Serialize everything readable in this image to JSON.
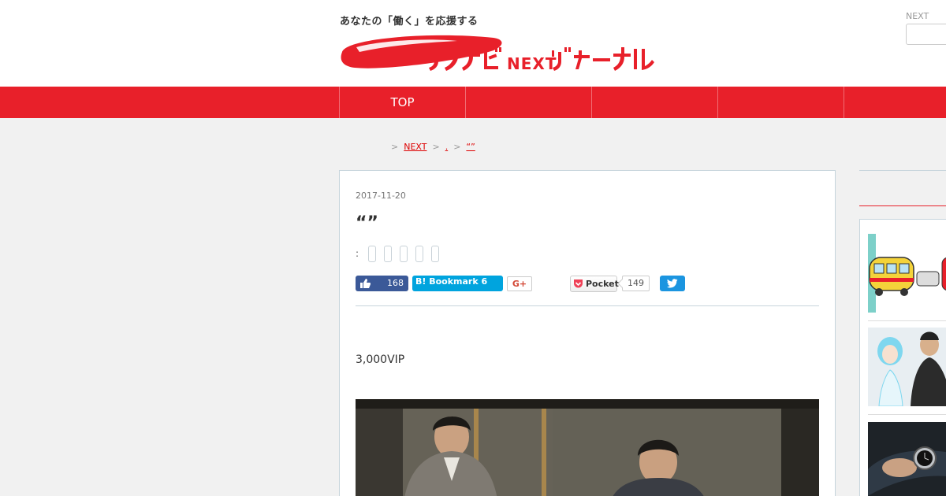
{
  "header": {
    "tagline": "あなたの「働く」を応援する",
    "logo_text": "リクナビNEXTジャーナル",
    "next_label": "NEXT",
    "search_placeholder": ""
  },
  "nav": {
    "items": [
      {
        "label": "TOP"
      },
      {
        "label": ""
      },
      {
        "label": ""
      },
      {
        "label": ""
      },
      {
        "label": ""
      }
    ]
  },
  "breadcrumb": {
    "items": [
      {
        "label": "          "
      },
      {
        "label": "NEXT "
      },
      {
        "label": "."
      },
      {
        "label": "“”                       "
      }
    ],
    "separator": ">"
  },
  "article": {
    "date": "2017-11-20",
    "title": "“”",
    "tag_colon": ":",
    "lead": "3,000VIP"
  },
  "share": {
    "like_count": "168",
    "hatena_label": "B! Bookmark 6",
    "gplus_label": "G+",
    "pocket_label": "Pocket",
    "pocket_count": "149"
  },
  "colors": {
    "brand_red": "#e8202a",
    "facebook": "#3b5998",
    "hatena": "#00a4de",
    "twitter": "#1b95e0"
  }
}
